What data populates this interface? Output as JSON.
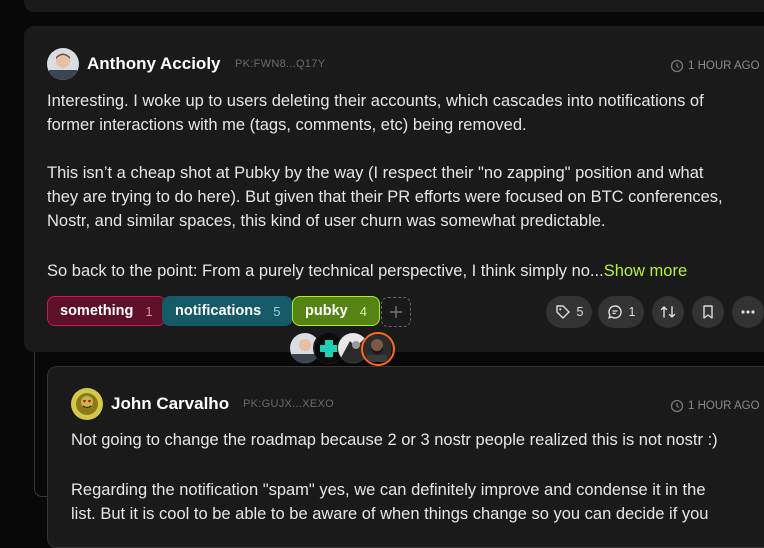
{
  "post": {
    "author": "Anthony Accioly",
    "pubkey": "PK:FWN8...Q17Y",
    "time": "1 HOUR AGO",
    "lines": [
      "Interesting. I woke up to users deleting their accounts, which cascades into notifications of",
      "former interactions with me (tags, comments, etc) being removed.",
      "This isn’t a cheap shot at Pubky by the way (I respect their \"no zapping\" position and what",
      "they are trying to do here). But given that their PR efforts were focused on BTC conferences,",
      "Nostr, and similar spaces, this kind of user churn was somewhat predictable.",
      "So back to the point: From a purely technical perspective, I think simply no..."
    ],
    "show_more": "Show more",
    "tags": [
      {
        "label": "something",
        "count": "1"
      },
      {
        "label": "notifications",
        "count": "5"
      },
      {
        "label": "pubky",
        "count": "4"
      }
    ],
    "actions": {
      "tags_count": "5",
      "replies_count": "1"
    },
    "icons": [
      "clock-icon",
      "tag-icon",
      "comment-icon",
      "repost-icon",
      "bookmark-icon",
      "more-icon",
      "plus-icon"
    ]
  },
  "reply": {
    "author": "John Carvalho",
    "pubkey": "PK:GUJX...XEXO",
    "time": "1 HOUR AGO",
    "lines": [
      "Not going to change the roadmap because 2 or 3 nostr people realized this is not nostr :)",
      "Regarding the notification \"spam\" yes, we can definitely improve and condense it in the",
      "list. But it is cool to be able to be aware of when things change so you can decide if you"
    ]
  },
  "colors": {
    "accent": "#b6f23c",
    "tag_red": "#c41f55",
    "tag_teal": "#155a66",
    "tag_green": "#a6f02a"
  }
}
